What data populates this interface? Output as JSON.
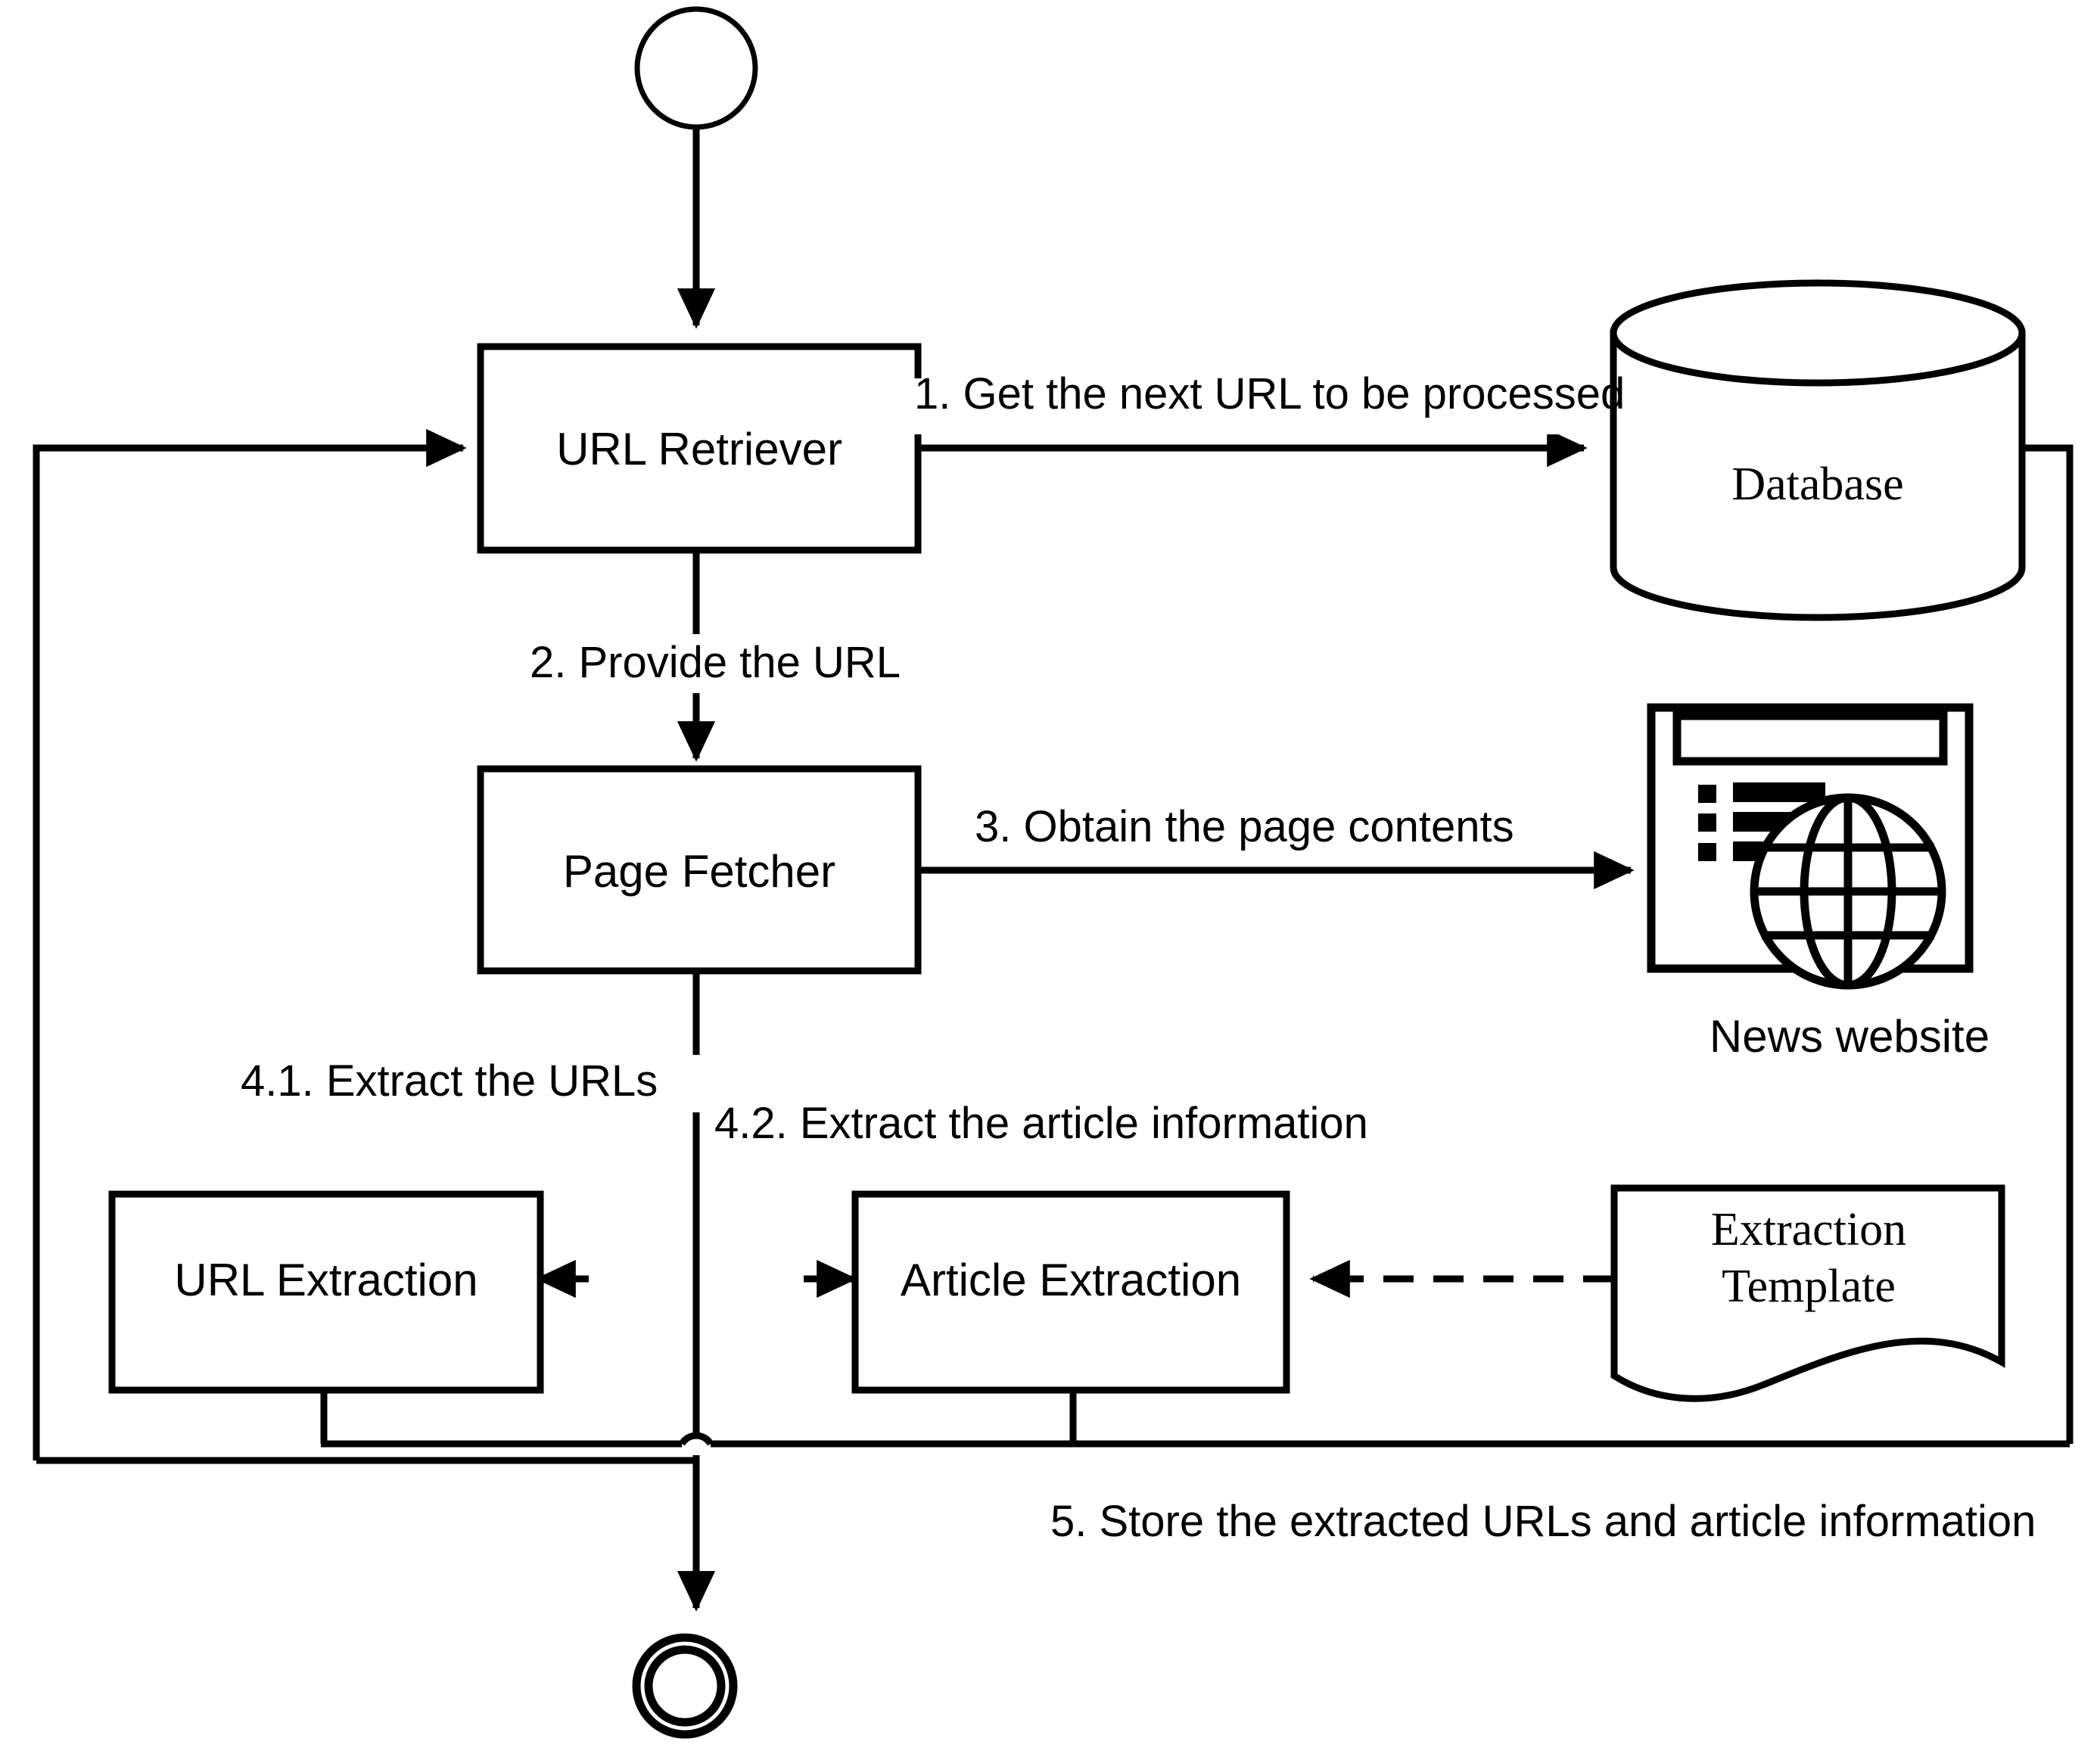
{
  "diagram": {
    "title": "News crawler architecture flowchart",
    "type": "flowchart",
    "nodes": {
      "start": {
        "label": "",
        "shape": "start-circle"
      },
      "url_retriever": {
        "label": "URL Retriever",
        "shape": "process-box"
      },
      "page_fetcher": {
        "label": "Page Fetcher",
        "shape": "process-box"
      },
      "url_extraction": {
        "label": "URL Extraction",
        "shape": "process-box"
      },
      "article_extraction": {
        "label": "Article Extraction",
        "shape": "process-box"
      },
      "database": {
        "label": "Database",
        "shape": "cylinder"
      },
      "news_website": {
        "label": "News website",
        "shape": "browser-globe-icon"
      },
      "extraction_template": {
        "label_line1": "Extraction",
        "label_line2": "Template",
        "shape": "document"
      },
      "end": {
        "label": "",
        "shape": "end-double-circle"
      }
    },
    "edges": {
      "step1": "1. Get the next URL to be processed",
      "step2": "2. Provide the URL",
      "step3": "3. Obtain the page contents",
      "step4_1": "4.1. Extract the URLs",
      "step4_2": "4.2. Extract the article information",
      "step5": "5. Store the extracted URLs and article information"
    },
    "colors": {
      "stroke": "#000000",
      "fill": "#ffffff",
      "end_node_gap": "#d4d4d4"
    }
  }
}
